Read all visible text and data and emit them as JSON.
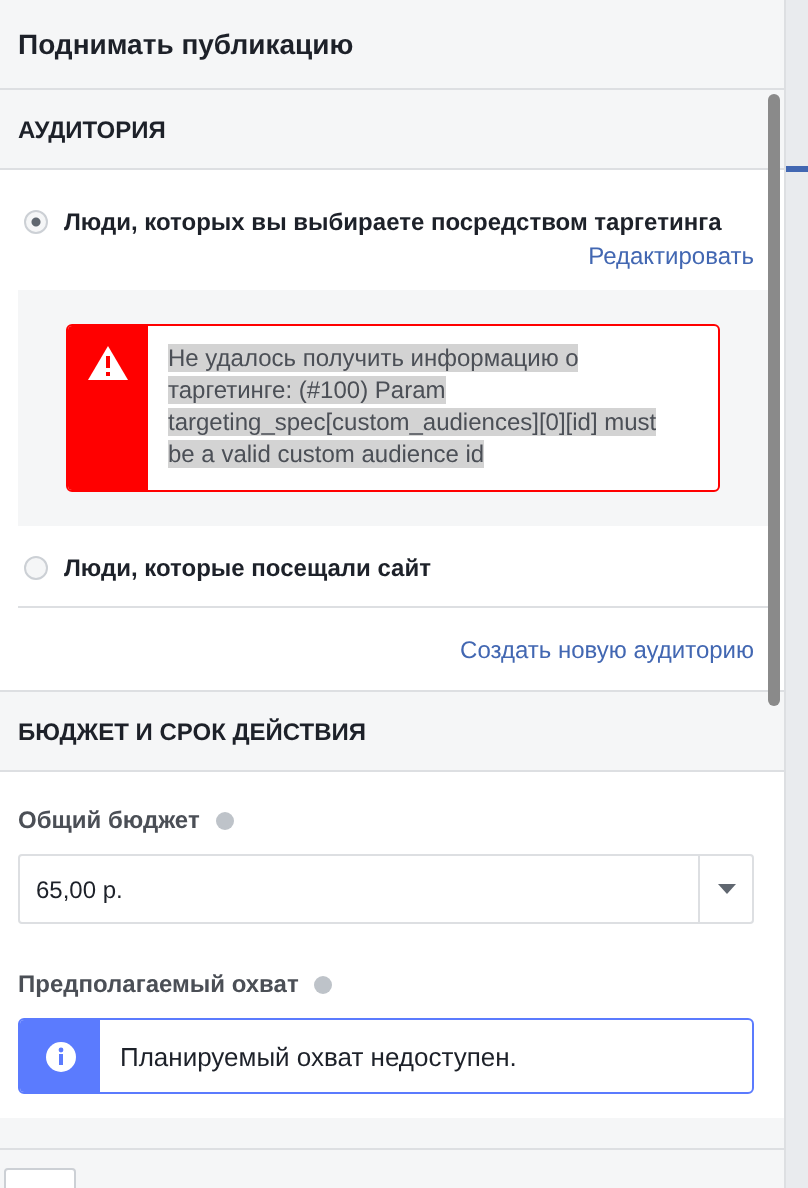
{
  "title": "Поднимать публикацию",
  "audience": {
    "heading": "АУДИТОРИЯ",
    "options": [
      {
        "label": "Люди, которых вы выбираете посредством таргетинга",
        "selected": true
      },
      {
        "label": "Люди, которые посещали сайт",
        "selected": false
      }
    ],
    "edit_link": "Редактировать",
    "error": "Не удалось получить информацию о таргетинге: (#100) Param targeting_spec[custom_audiences][0][id] must be a valid custom audience id",
    "create_link": "Создать новую аудиторию"
  },
  "budget": {
    "heading": "БЮДЖЕТ И СРОК ДЕЙСТВИЯ",
    "total_label": "Общий бюджет",
    "total_value": "65,00 р.",
    "reach_label": "Предполагаемый охват",
    "reach_message": "Планируемый охват недоступен."
  }
}
